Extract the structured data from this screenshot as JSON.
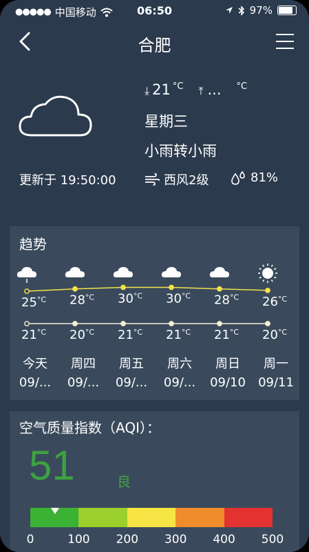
{
  "status": {
    "carrier": "中国移动",
    "time": "06:50",
    "battery": "97%"
  },
  "header": {
    "city": "合肥"
  },
  "current": {
    "icon": "cloud-icon",
    "low": "21",
    "low_unit": "°C",
    "high": "...",
    "high_unit": "°C",
    "weekday": "星期三",
    "description": "小雨转小雨",
    "update": "更新于 19:50:00",
    "wind": "西风2级",
    "humidity": "81%"
  },
  "trend": {
    "title": "趋势",
    "days": [
      {
        "name": "今天",
        "date": "09/...",
        "high": 25,
        "low": 21,
        "icon": "light-rain-cloud-icon"
      },
      {
        "name": "周四",
        "date": "09/...",
        "high": 28,
        "low": 20,
        "icon": "cloud-icon"
      },
      {
        "name": "周五",
        "date": "09/...",
        "high": 30,
        "low": 21,
        "icon": "cloud-icon"
      },
      {
        "name": "周六",
        "date": "09/...",
        "high": 30,
        "low": 21,
        "icon": "cloud-icon"
      },
      {
        "name": "周日",
        "date": "09/10",
        "high": 28,
        "low": 21,
        "icon": "cloud-icon"
      },
      {
        "name": "周一",
        "date": "09/11",
        "high": 26,
        "low": 20,
        "icon": "sun-icon"
      }
    ],
    "unit": "°C",
    "high_color": "#f2e24b",
    "low_color": "#f5f0d6"
  },
  "aqi": {
    "title": "空气质量指数（AQI）：",
    "value": "51",
    "level": "良",
    "level_color": "#3ea142",
    "scale_colors": [
      "#3bb234",
      "#9bcf2c",
      "#f7e545",
      "#ef8c2c",
      "#e3322f"
    ],
    "ticks": [
      "0",
      "100",
      "200",
      "300",
      "400",
      "500"
    ],
    "fraction": 0.102
  }
}
